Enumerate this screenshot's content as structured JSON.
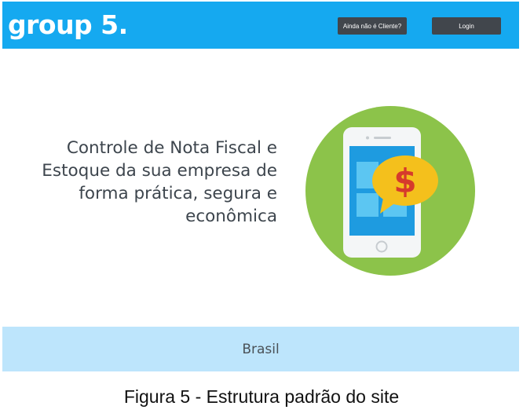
{
  "header": {
    "logo": "group 5.",
    "client_button_label": "Ainda não é Cliente?",
    "login_button_label": "Login"
  },
  "hero": {
    "headline_lines": [
      "Controle de Nota Fiscal e",
      "Estoque da sua empresa de",
      "forma prática, segura e",
      "econômica"
    ],
    "illustration": {
      "icon": "smartphone-dollar-icon",
      "symbol": "$"
    }
  },
  "footer": {
    "text": "Brasil"
  },
  "caption": "Figura 5 - Estrutura padrão do site",
  "colors": {
    "header_bg": "#15a9f0",
    "button_bg": "#41464c",
    "footer_bg": "#bde5fc",
    "circle_green": "#8cc34a",
    "phone_blue": "#1e9be0",
    "coin_yellow": "#f4c01c",
    "dollar_red": "#d63a2c"
  }
}
